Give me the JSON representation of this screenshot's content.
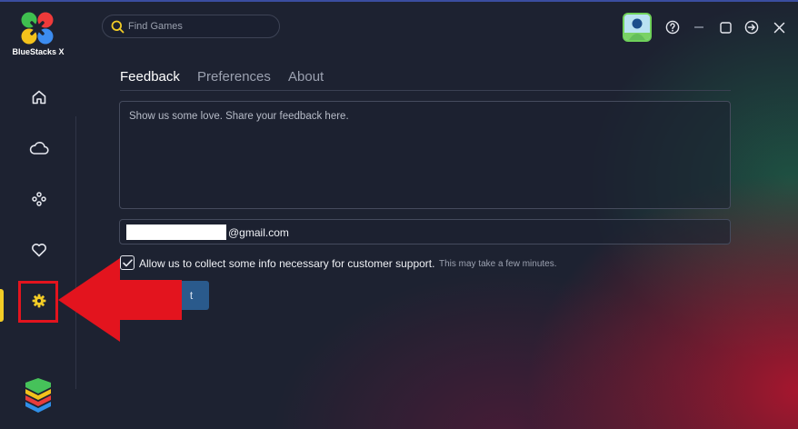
{
  "app": {
    "name": "BlueStacks X"
  },
  "search": {
    "placeholder": "Find Games"
  },
  "sidebar": {
    "items": [
      {
        "id": "home",
        "icon": "home-icon"
      },
      {
        "id": "cloud",
        "icon": "cloud-icon"
      },
      {
        "id": "games",
        "icon": "gamepad-icon"
      },
      {
        "id": "favorites",
        "icon": "heart-icon"
      },
      {
        "id": "settings",
        "icon": "gear-icon",
        "active": true
      }
    ]
  },
  "window_controls": [
    "help-icon",
    "minimize-icon",
    "maximize-icon",
    "exit-icon",
    "close-icon"
  ],
  "tabs": [
    {
      "label": "Feedback",
      "active": true
    },
    {
      "label": "Preferences",
      "active": false
    },
    {
      "label": "About",
      "active": false
    }
  ],
  "feedback": {
    "placeholder": "Show us some love. Share your feedback here.",
    "email_domain": "@gmail.com",
    "consent_label": "Allow us to collect some info necessary for customer support.",
    "consent_checked": true,
    "consent_note": "This may take a few minutes.",
    "submit_label": "t"
  },
  "colors": {
    "accent": "#f2cc26",
    "highlight": "#e3141e",
    "background": "#1d2231",
    "submit": "#2a5a8c"
  }
}
